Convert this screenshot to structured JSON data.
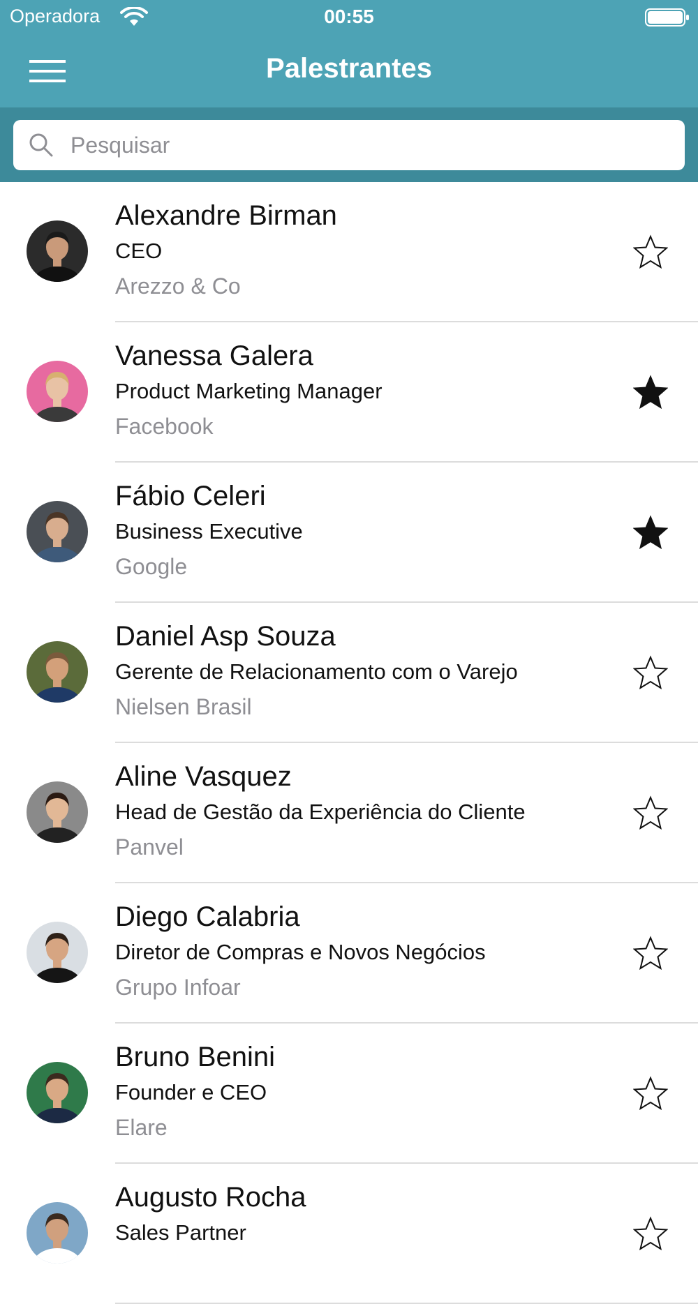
{
  "status_bar": {
    "carrier": "Operadora",
    "time": "00:55",
    "icons": [
      "wifi-icon",
      "battery-icon"
    ]
  },
  "nav_bar": {
    "title": "Palestrantes",
    "menu_icon": "menu-icon"
  },
  "search": {
    "placeholder": "Pesquisar",
    "value": "",
    "icon": "search-icon"
  },
  "colors": {
    "header": "#4da3b5",
    "search_bar": "#3d8a9a",
    "text_primary": "#111111",
    "text_secondary": "#8e8e93",
    "divider": "#dcdcdc"
  },
  "speakers": [
    {
      "name": "Alexandre Birman",
      "role": "CEO",
      "company": "Arezzo & Co",
      "favorite": false,
      "avatar_bg": "#2b2b2b",
      "avatar_skin": "#c99a7a",
      "avatar_hair": "#1a1a1a",
      "avatar_shirt": "#111111"
    },
    {
      "name": "Vanessa Galera",
      "role": "Product Marketing Manager",
      "company": "Facebook",
      "favorite": true,
      "avatar_bg": "#e76aa0",
      "avatar_skin": "#e8c2a5",
      "avatar_hair": "#d7b070",
      "avatar_shirt": "#3a3a3a"
    },
    {
      "name": "Fábio Celeri",
      "role": "Business Executive",
      "company": "Google",
      "favorite": true,
      "avatar_bg": "#4a4f55",
      "avatar_skin": "#d8ad8e",
      "avatar_hair": "#4a3526",
      "avatar_shirt": "#3e5a7a"
    },
    {
      "name": "Daniel Asp Souza",
      "role": "Gerente de Relacionamento com o Varejo",
      "company": "Nielsen Brasil",
      "favorite": false,
      "avatar_bg": "#5b6b3a",
      "avatar_skin": "#d3a07a",
      "avatar_hair": "#7a5a3c",
      "avatar_shirt": "#1f3a66"
    },
    {
      "name": "Aline Vasquez",
      "role": "Head de Gestão da Experiência do Cliente",
      "company": "Panvel",
      "favorite": false,
      "avatar_bg": "#8a8a8a",
      "avatar_skin": "#e2b896",
      "avatar_hair": "#2a1a12",
      "avatar_shirt": "#222222"
    },
    {
      "name": "Diego Calabria",
      "role": "Diretor de Compras e Novos Negócios",
      "company": "Grupo Infoar",
      "favorite": false,
      "avatar_bg": "#d9dee3",
      "avatar_skin": "#d6a582",
      "avatar_hair": "#2e2118",
      "avatar_shirt": "#151515"
    },
    {
      "name": "Bruno Benini",
      "role": "Founder e CEO",
      "company": "Elare",
      "favorite": false,
      "avatar_bg": "#2f7a4a",
      "avatar_skin": "#d9a985",
      "avatar_hair": "#3b2a1e",
      "avatar_shirt": "#1c2a44"
    },
    {
      "name": "Augusto Rocha",
      "role": "Sales Partner",
      "company": "",
      "favorite": false,
      "avatar_bg": "#7fa7c7",
      "avatar_skin": "#d0a07e",
      "avatar_hair": "#3a2a1f",
      "avatar_shirt": "#ffffff"
    }
  ]
}
